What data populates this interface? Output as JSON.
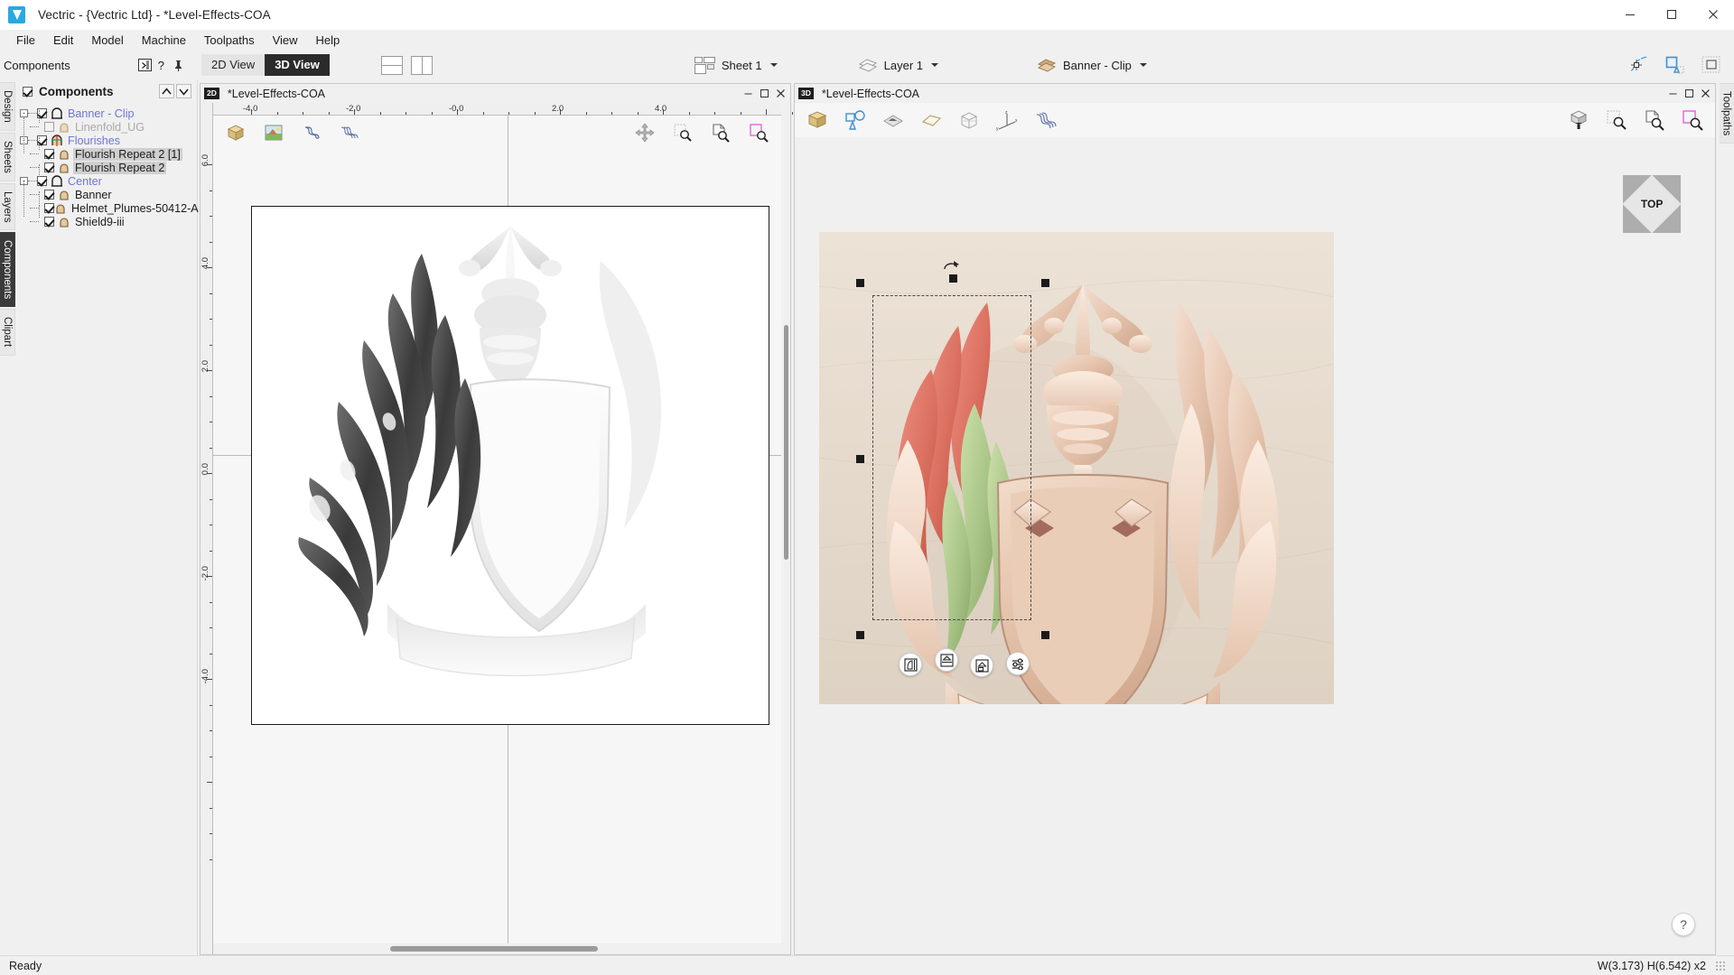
{
  "window": {
    "title": "Vectric - {Vectric Ltd} - *Level-Effects-COA",
    "logo_icon": "vectric-logo-icon",
    "minimize_icon": "minimize-icon",
    "maximize_icon": "maximize-icon",
    "close_icon": "close-icon"
  },
  "menubar": {
    "items": [
      {
        "label": "File"
      },
      {
        "label": "Edit"
      },
      {
        "label": "Model"
      },
      {
        "label": "Machine"
      },
      {
        "label": "Toolpaths"
      },
      {
        "label": "View"
      },
      {
        "label": "Help"
      }
    ]
  },
  "panel_header": {
    "title": "Components",
    "collapse_icon": "collapse-panel-icon",
    "help_label": "?",
    "pin_icon": "pin-icon"
  },
  "toolbar": {
    "view_tabs": [
      {
        "label": "2D View",
        "active": false
      },
      {
        "label": "3D View",
        "active": true
      }
    ],
    "layout_horizontal_icon": "layout-split-horizontal-icon",
    "layout_vertical_icon": "layout-split-vertical-icon",
    "sheet": {
      "label": "Sheet 1",
      "icon": "sheet-icon"
    },
    "layer": {
      "label": "Layer 1",
      "icon": "layer-icon"
    },
    "level": {
      "label": "Banner - Clip",
      "icon": "level-icon"
    },
    "right_icons": [
      {
        "name": "node-edit-icon"
      },
      {
        "name": "vector-select-icon"
      },
      {
        "name": "select-all-icon"
      }
    ]
  },
  "left_tabs": [
    {
      "label": "Design",
      "active": false
    },
    {
      "label": "Sheets",
      "active": false
    },
    {
      "label": "Layers",
      "active": false
    },
    {
      "label": "Components",
      "active": true
    },
    {
      "label": "Clipart",
      "active": false
    }
  ],
  "right_tabs": [
    {
      "label": "Toolpaths",
      "active": false
    }
  ],
  "components": {
    "root_label": "Components",
    "root_checked": true,
    "move_up_icon": "move-up-icon",
    "move_down_icon": "move-down-icon",
    "tree": [
      {
        "label": "Banner - Clip",
        "level": 0,
        "type": "group",
        "checked": true,
        "expander": "-",
        "icon": "level-group-icon",
        "selected": false,
        "faint": false
      },
      {
        "label": "Linenfold_UG",
        "level": 1,
        "type": "component",
        "checked": false,
        "icon": "component-icon",
        "selected": false,
        "faint": true
      },
      {
        "label": "Flourishes",
        "level": 0,
        "type": "group",
        "checked": true,
        "expander": "-",
        "icon": "level-group-active-icon",
        "selected": false,
        "faint": false
      },
      {
        "label": "Flourish Repeat 2 [1]",
        "level": 1,
        "type": "component",
        "checked": true,
        "icon": "component-icon",
        "selected": true,
        "faint": false
      },
      {
        "label": "Flourish Repeat 2",
        "level": 1,
        "type": "component",
        "checked": true,
        "icon": "component-icon",
        "selected": true,
        "faint": false
      },
      {
        "label": "Center",
        "level": 0,
        "type": "group",
        "checked": true,
        "expander": "-",
        "icon": "level-group-icon",
        "selected": false,
        "faint": false
      },
      {
        "label": "Banner",
        "level": 1,
        "type": "component",
        "checked": true,
        "icon": "component-icon",
        "selected": false,
        "faint": false
      },
      {
        "label": "Helmet_Plumes-50412-A",
        "level": 1,
        "type": "component",
        "checked": true,
        "icon": "component-icon",
        "selected": false,
        "faint": false
      },
      {
        "label": "Shield9-iii",
        "level": 1,
        "type": "component",
        "checked": true,
        "icon": "component-icon",
        "selected": false,
        "faint": false
      }
    ]
  },
  "view2d": {
    "badge": "2D",
    "doc_name": "*Level-Effects-COA",
    "minimize_icon": "minimize-icon",
    "maximize_icon": "maximize-icon",
    "close_icon": "close-icon",
    "toolbar_left": [
      {
        "name": "3d-model-icon"
      },
      {
        "name": "bitmap-image-icon"
      },
      {
        "name": "toolpath-preview-icon"
      },
      {
        "name": "toolpath-multi-icon"
      }
    ],
    "toolbar_right": [
      {
        "name": "pan-icon"
      },
      {
        "name": "zoom-box-icon"
      },
      {
        "name": "zoom-page-icon"
      },
      {
        "name": "zoom-selection-icon"
      }
    ],
    "ruler_top_labels": [
      "-4.0",
      "-2.0",
      "-0.0",
      "2.0",
      "4.0"
    ],
    "ruler_left_labels": [
      "6.0",
      "4.0",
      "2.0",
      "0.0",
      "-2.0",
      "-4.0"
    ]
  },
  "view3d": {
    "badge": "3D",
    "doc_name": "*Level-Effects-COA",
    "minimize_icon": "minimize-icon",
    "maximize_icon": "maximize-icon",
    "close_icon": "close-icon",
    "toolbar_left": [
      {
        "name": "material-block-icon"
      },
      {
        "name": "shape-outline-icon"
      },
      {
        "name": "shaded-preview-icon"
      },
      {
        "name": "flat-plane-icon"
      },
      {
        "name": "wireframe-box-icon"
      },
      {
        "name": "axis-gizmo-icon"
      },
      {
        "name": "toolpath-wave-icon"
      }
    ],
    "toolbar_right": [
      {
        "name": "isometric-view-icon"
      },
      {
        "name": "zoom-box-icon"
      },
      {
        "name": "zoom-page-icon"
      },
      {
        "name": "zoom-selection-icon"
      }
    ],
    "viewcube_label": "TOP",
    "floating_buttons": [
      {
        "name": "mirror-left-icon"
      },
      {
        "name": "mirror-top-icon"
      },
      {
        "name": "mirror-bottom-icon"
      },
      {
        "name": "component-settings-icon"
      }
    ],
    "help_label": "?"
  },
  "statusbar": {
    "message": "Ready",
    "dimensions": "W(3.173) H(6.542) x2"
  },
  "colors": {
    "accent": "#29a8e0",
    "group_text": "#6f74d8",
    "selection": "#cfcfcf",
    "active_tab_bg": "#2b2b2b",
    "wood": "#e2d7ca",
    "heraldic_red": "#d9705f",
    "heraldic_green": "#a7c385"
  }
}
